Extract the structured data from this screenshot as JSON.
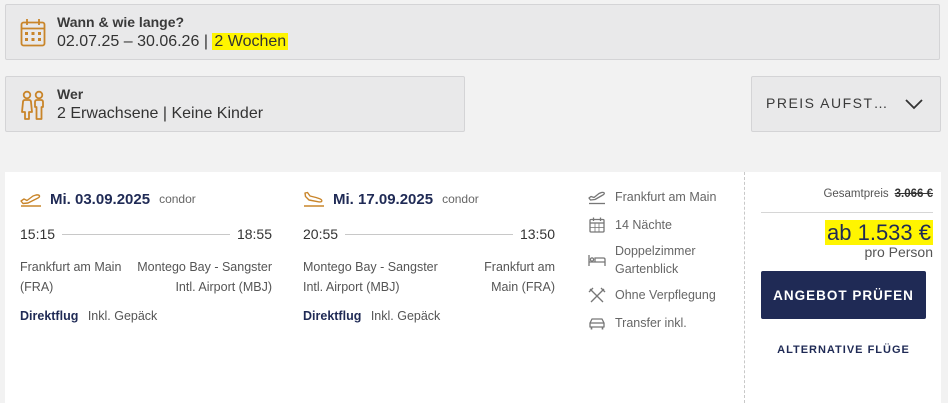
{
  "when": {
    "label": "Wann & wie lange?",
    "dates": "02.07.25 – 30.06.26",
    "separator": "|",
    "duration": "2 Wochen",
    "icon": "calendar-icon"
  },
  "who": {
    "label": "Wer",
    "value": "2 Erwachsene | Keine Kinder",
    "icon": "family-icon"
  },
  "sort": {
    "label": "PREIS AUFST…",
    "icon": "chevron-down-icon"
  },
  "offer": {
    "outbound": {
      "date": "Mi. 03.09.2025",
      "carrier": "condor",
      "depart_time": "15:15",
      "arrive_time": "18:55",
      "from": "Frankfurt am Main (FRA)",
      "to": "Montego Bay - Sangster Intl. Airport (MBJ)",
      "direct": "Direktflug",
      "baggage": "Inkl. Gepäck",
      "icon": "plane-takeoff-icon"
    },
    "return": {
      "date": "Mi. 17.09.2025",
      "carrier": "condor",
      "depart_time": "20:55",
      "arrive_time": "13:50",
      "from": "Montego Bay - Sangster Intl. Airport (MBJ)",
      "to": "Frankfurt am Main (FRA)",
      "direct": "Direktflug",
      "baggage": "Inkl. Gepäck",
      "icon": "plane-landing-icon"
    },
    "features": [
      {
        "icon": "plane-icon",
        "text": "Frankfurt am Main"
      },
      {
        "icon": "calendar-icon",
        "text": "14 Nächte"
      },
      {
        "icon": "bed-icon",
        "text": "Doppelzimmer Gartenblick"
      },
      {
        "icon": "cutlery-icon",
        "text": "Ohne Verpflegung"
      },
      {
        "icon": "car-icon",
        "text": "Transfer inkl."
      }
    ],
    "price": {
      "total_label": "Gesamtpreis",
      "total_value": "3.066 €",
      "price": "ab 1.533 €",
      "per": "pro Person",
      "cta": "ANGEBOT PRÜFEN",
      "alt": "ALTERNATIVE FLÜGE"
    }
  },
  "colors": {
    "navy": "#1f2a55",
    "highlight": "#fff500",
    "icon_orange": "#c9852a",
    "background": "#f2f2f2"
  }
}
